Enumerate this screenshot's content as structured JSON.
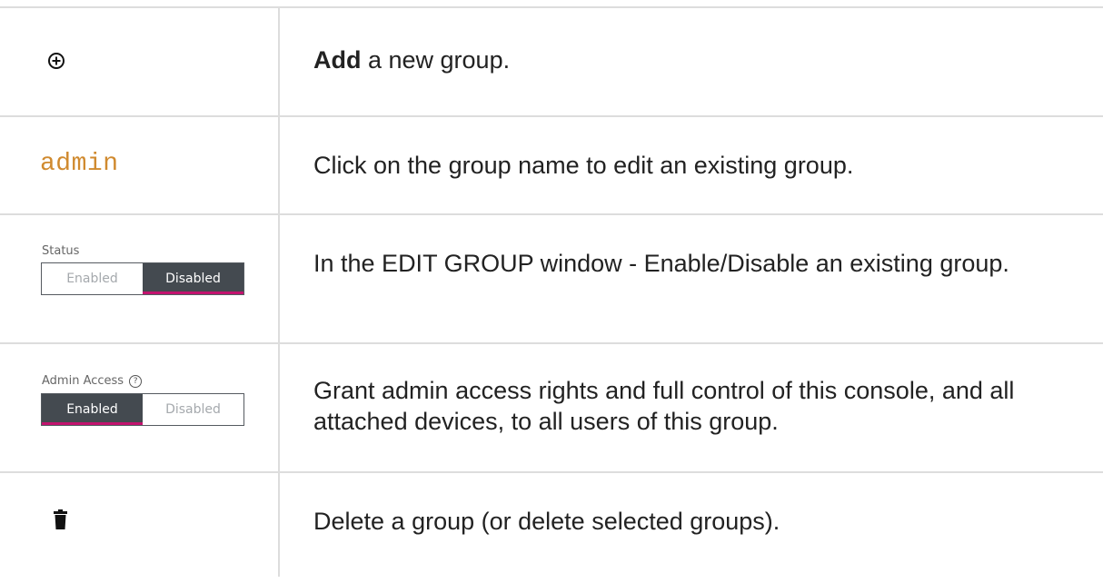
{
  "rows": [
    {
      "icon": "add-circle-icon",
      "desc_bold": "Add",
      "desc_rest": " a new group."
    },
    {
      "link_text": "admin",
      "link_color": "#d08a2f",
      "desc": "Click on the group name to edit an existing group."
    },
    {
      "toggle": {
        "label": "Status",
        "options": [
          "Enabled",
          "Disabled"
        ],
        "selected": "Disabled"
      },
      "desc": "In the EDIT GROUP window - Enable/Disable an existing group."
    },
    {
      "toggle": {
        "label": "Admin Access",
        "help_icon": "help-circle-icon",
        "options": [
          "Enabled",
          "Disabled"
        ],
        "selected": "Enabled"
      },
      "desc": "Grant admin access rights and full control of this console, and all attached devices, to all users of this group."
    },
    {
      "icon": "trash-icon",
      "desc": "Delete a group (or delete selected groups)."
    }
  ],
  "colors": {
    "toggle_active": "#444a50",
    "toggle_accent": "#c2136e",
    "border": "#dddddd"
  }
}
